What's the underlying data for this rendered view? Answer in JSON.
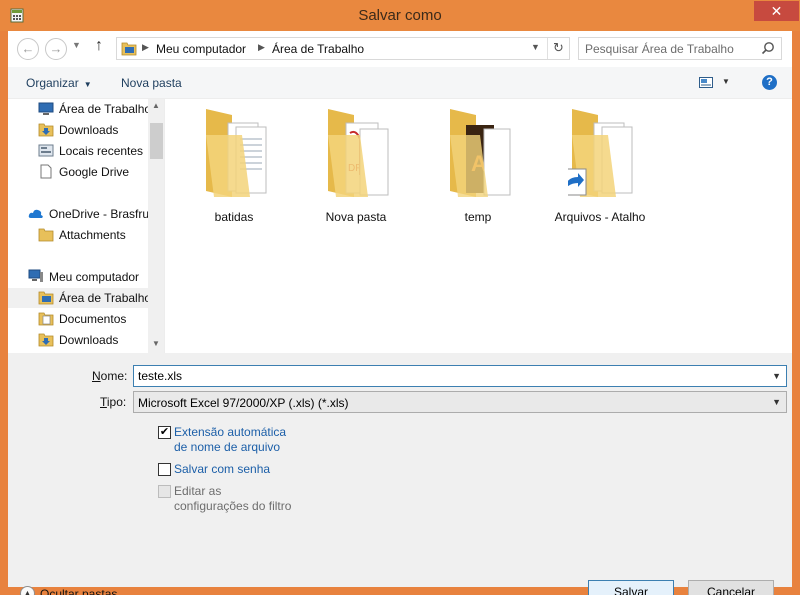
{
  "window": {
    "title": "Salvar como",
    "close_label": "✕",
    "accent_color": "#e9883f"
  },
  "address": {
    "back_icon": "arrow-left-icon",
    "forward_icon": "arrow-right-icon",
    "up_icon": "arrow-up-icon",
    "crumbs": [
      "Meu computador",
      "Área de Trabalho"
    ],
    "refresh_icon": "refresh-icon"
  },
  "search": {
    "placeholder": "Pesquisar Área de Trabalho"
  },
  "toolbar": {
    "organize_label": "Organizar",
    "new_folder_label": "Nova pasta",
    "help_label": "?"
  },
  "navpane": {
    "items": [
      {
        "label": "Área de Trabalho",
        "icon": "desktop-icon"
      },
      {
        "label": "Downloads",
        "icon": "downloads-icon"
      },
      {
        "label": "Locais recentes",
        "icon": "recent-places-icon"
      },
      {
        "label": "Google Drive",
        "icon": "document-icon"
      },
      {
        "label": "OneDrive - Brasfrut",
        "icon": "onedrive-cloud-icon"
      },
      {
        "label": "Attachments",
        "icon": "folder-icon"
      },
      {
        "label": "Meu computador",
        "icon": "computer-icon"
      },
      {
        "label": "Área de Trabalho",
        "icon": "desktop-icon"
      },
      {
        "label": "Documentos",
        "icon": "documents-icon"
      },
      {
        "label": "Downloads",
        "icon": "downloads-icon"
      }
    ],
    "selected_index": 7
  },
  "content": {
    "folders": [
      {
        "name": "batidas",
        "icon": "folder-with-documents-icon"
      },
      {
        "name": "Nova pasta",
        "icon": "folder-with-pdf-icon"
      },
      {
        "name": "temp",
        "icon": "folder-with-illustrator-icon"
      },
      {
        "name": "Arquivos - Atalho",
        "icon": "folder-shortcut-icon"
      }
    ]
  },
  "form": {
    "filename_label_u": "N",
    "filename_label_rest": "ome:",
    "filename_value": "teste.xls",
    "type_label_u": "T",
    "type_label_rest": "ipo:",
    "type_value": "Microsoft Excel 97/2000/XP (.xls) (*.xls)",
    "options": [
      {
        "label": "Extensão automática de nome de arquivo",
        "checked": true,
        "enabled": true
      },
      {
        "label": "Salvar com senha",
        "checked": false,
        "enabled": true
      },
      {
        "label": "Editar as configurações do filtro",
        "checked": false,
        "enabled": false
      }
    ]
  },
  "footer": {
    "hide_folders_label": "Ocultar pastas",
    "save_label": "Salvar",
    "cancel_label": "Cancelar"
  }
}
